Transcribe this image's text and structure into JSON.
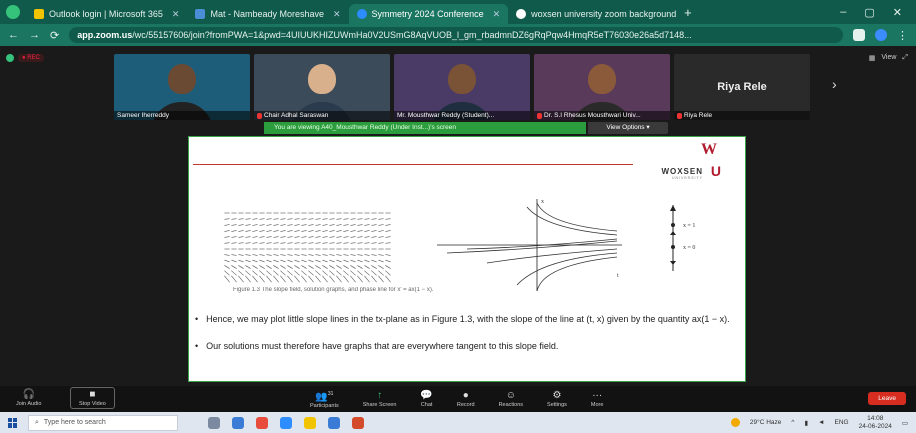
{
  "browser": {
    "tabs": [
      {
        "label": "Outlook login | Microsoft 365",
        "favicon_color": "#f2c400",
        "active": false
      },
      {
        "label": "Mat - Nambeady Moreshave",
        "favicon_color": "#4a8fd6",
        "active": false
      },
      {
        "label": "Symmetry 2024 Conference",
        "favicon_color": "#2d8cff",
        "active": true
      },
      {
        "label": "woxsen university zoom background",
        "favicon_color": "#ffffff",
        "active": false
      }
    ],
    "new_tab": "+",
    "window_controls": [
      "–",
      "▢",
      "✕"
    ],
    "nav": {
      "back": "←",
      "forward": "→",
      "reload": "⟳"
    },
    "url_domain": "app.zoom.us",
    "url_rest": "/wc/55157606/join?fromPWA=1&pwd=4UIUUKHIZUWmHa0V2USmG8AqVUOB_l_gm_rbadmnDZ6gRqPqw4HmqR5eT76030e26a5d7148..."
  },
  "zoom": {
    "rec_label": "● REC",
    "view_label": "View",
    "participants": [
      {
        "name": "Sameer Iherreddy",
        "bg": "#1e5d7a",
        "skin": "#6b4a34",
        "shirt": "#222222",
        "muted": false
      },
      {
        "name": "Chair Adhal Saraswan",
        "bg": "#3c4b5a",
        "skin": "#d8b08c",
        "shirt": "#2a3b4d",
        "muted": true
      },
      {
        "name": "Mr. Mousthwar Reddy (Student)...",
        "bg": "#4a3a66",
        "skin": "#7a5236",
        "shirt": "#1f2f3f",
        "muted": false
      },
      {
        "name": "Dr. S.I Rhesus Mousthwari Univ...",
        "bg": "#5a3a5a",
        "skin": "#8a5a3a",
        "shirt": "#2a2a2a",
        "muted": true
      }
    ],
    "name_tile": {
      "big_name": "Riya Rele",
      "label": "Riya Rele",
      "muted": true
    },
    "more_arrow": "›",
    "share_banner": "You are viewing  A40_Mousthwar Reddy (Under Inst...)'s screen",
    "view_options": "View Options ▾",
    "slide": {
      "logo_top": "W",
      "logo_name": "WOXSEN",
      "logo_u": "U",
      "logo_sub": "UNIVERSITY",
      "figure_caption": "Figure 1.3   The slope field, solution graphs, and phase line for x' = ax(1 − x).",
      "phase_labels": [
        "x = 1",
        "x = 0"
      ],
      "axis_t": "t",
      "axis_x": "x",
      "bullets": [
        "Hence, we may plot little slope lines in the tx-plane as in Figure 1.3, with the slope of the line at (t, x) given by the quantity ax(1 − x).",
        "Our solutions must therefore have graphs that are everywhere tangent to this slope field."
      ]
    },
    "controls": {
      "left": [
        {
          "icon": "🎧",
          "label": "Join Audio"
        },
        {
          "icon": "■",
          "label": "Stop Video"
        }
      ],
      "center": [
        {
          "icon": "👥",
          "label": "Participants",
          "badge": "31"
        },
        {
          "icon": "↑",
          "label": "Share Screen"
        },
        {
          "icon": "💬",
          "label": "Chat"
        },
        {
          "icon": "●",
          "label": "Record"
        },
        {
          "icon": "☺",
          "label": "Reactions"
        },
        {
          "icon": "⚙",
          "label": "Settings"
        },
        {
          "icon": "···",
          "label": "More"
        }
      ],
      "leave": "Leave"
    }
  },
  "taskbar": {
    "search_placeholder": "Type here to search",
    "weather": "29°C Haze",
    "lang": "ENG",
    "clock_time": "14:08",
    "clock_date": "24-06-2024",
    "apps": [
      "#7b8aa0",
      "#3a7bd5",
      "#e84c3d",
      "#2d8cff",
      "#f2c400",
      "#3a7bd5",
      "#d34b2a"
    ]
  }
}
